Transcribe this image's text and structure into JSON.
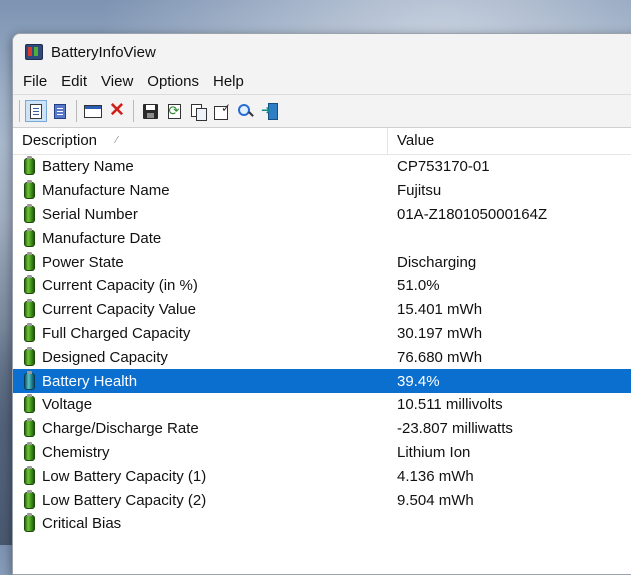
{
  "window": {
    "title": "BatteryInfoView"
  },
  "menu": [
    "File",
    "Edit",
    "View",
    "Options",
    "Help"
  ],
  "toolbar": {
    "buttons": [
      "properties-view-icon",
      "all-items-view-icon",
      "html-report-icon",
      "delete-icon",
      "save-icon",
      "refresh-icon",
      "copy-icon",
      "properties-icon",
      "find-icon",
      "exit-icon"
    ]
  },
  "columns": {
    "description": "Description",
    "value": "Value"
  },
  "rows": [
    {
      "description": "Battery Name",
      "value": "CP753170-01"
    },
    {
      "description": "Manufacture Name",
      "value": "Fujitsu"
    },
    {
      "description": "Serial Number",
      "value": "01A-Z180105000164Z"
    },
    {
      "description": "Manufacture Date",
      "value": ""
    },
    {
      "description": "Power State",
      "value": "Discharging"
    },
    {
      "description": "Current Capacity (in %)",
      "value": "51.0%"
    },
    {
      "description": "Current Capacity Value",
      "value": "15.401 mWh"
    },
    {
      "description": "Full Charged Capacity",
      "value": "30.197 mWh"
    },
    {
      "description": "Designed Capacity",
      "value": "76.680 mWh"
    },
    {
      "description": "Battery Health",
      "value": "39.4%"
    },
    {
      "description": "Voltage",
      "value": "10.511 millivolts"
    },
    {
      "description": "Charge/Discharge Rate",
      "value": "-23.807 milliwatts"
    },
    {
      "description": "Chemistry",
      "value": "Lithium Ion"
    },
    {
      "description": "Low Battery Capacity (1)",
      "value": "4.136 mWh"
    },
    {
      "description": "Low Battery Capacity (2)",
      "value": "9.504 mWh"
    },
    {
      "description": "Critical Bias",
      "value": ""
    }
  ],
  "selected_row": "Battery Health",
  "colors": {
    "selection": "#0b6fcf",
    "battery_icon": "#4fa52a"
  }
}
